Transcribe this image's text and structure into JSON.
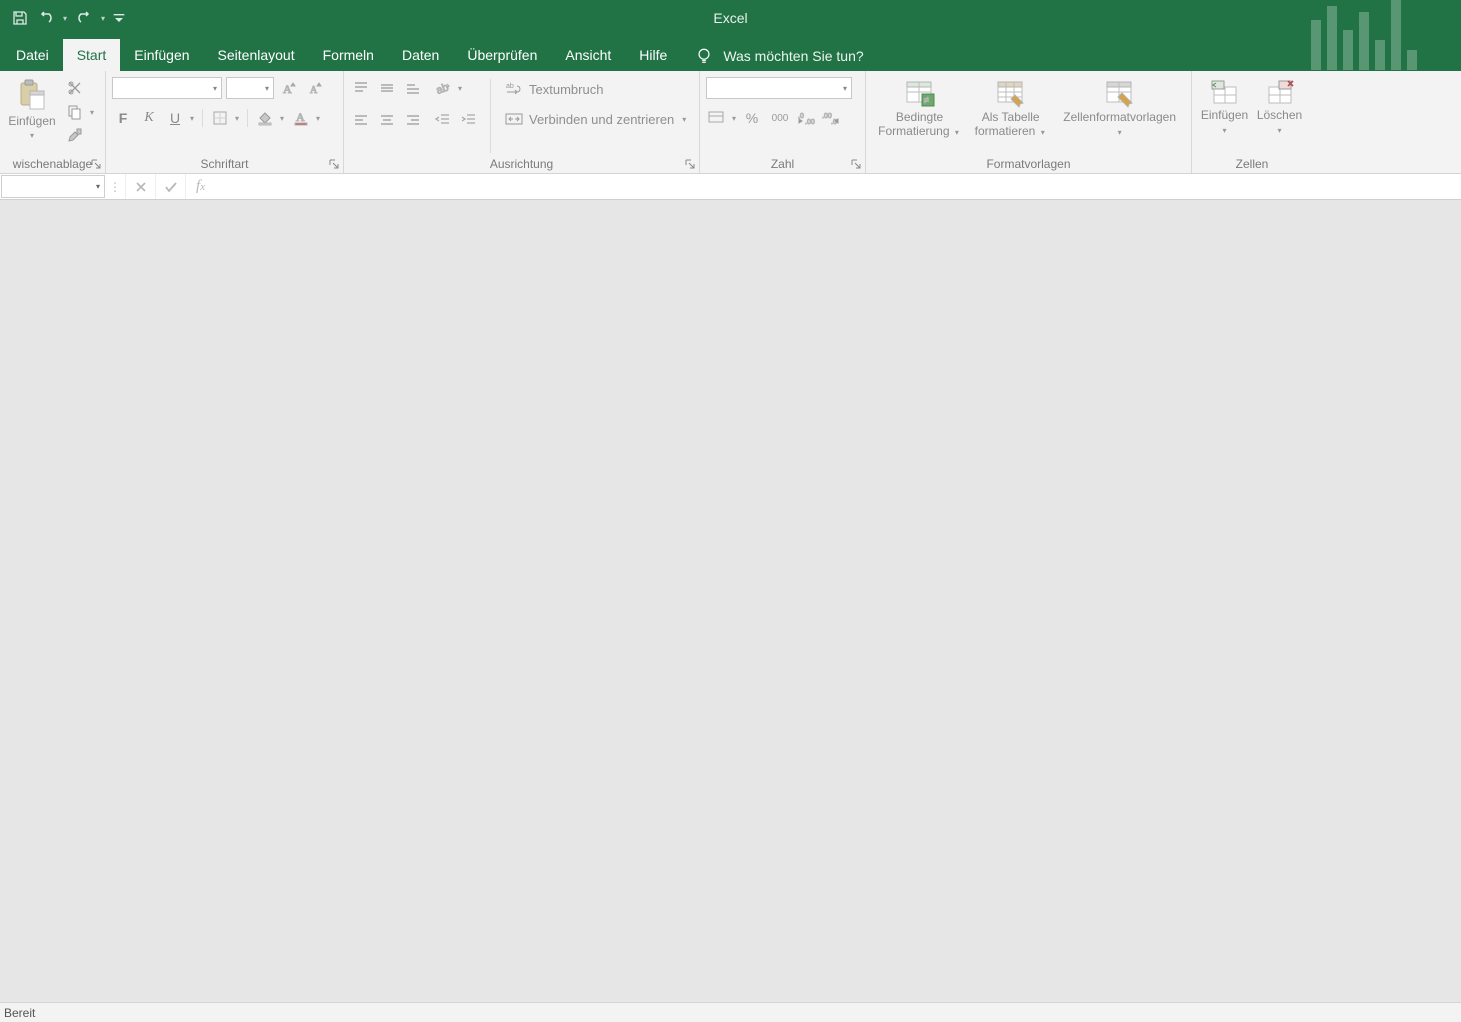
{
  "app": {
    "title": "Excel"
  },
  "tabs": {
    "datei": "Datei",
    "start": "Start",
    "einfuegen": "Einfügen",
    "seitenlayout": "Seitenlayout",
    "formeln": "Formeln",
    "daten": "Daten",
    "ueberpruefen": "Überprüfen",
    "ansicht": "Ansicht",
    "hilfe": "Hilfe",
    "tellme": "Was möchten Sie tun?"
  },
  "ribbon": {
    "clipboard": {
      "label": "wischenablage",
      "paste": "Einfügen"
    },
    "font": {
      "label": "Schriftart",
      "bold": "F",
      "italic": "K",
      "underline": "U"
    },
    "alignment": {
      "label": "Ausrichtung",
      "wrap": "Textumbruch",
      "merge": "Verbinden und zentrieren"
    },
    "number": {
      "label": "Zahl",
      "thousand": "000"
    },
    "styles": {
      "label": "Formatvorlagen",
      "conditional": "Bedingte Formatierung",
      "astable": "Als Tabelle formatieren",
      "cellstyles": "Zellenformatvorlagen"
    },
    "cells": {
      "label": "Zellen",
      "insert": "Einfügen",
      "delete": "Löschen"
    }
  },
  "status": {
    "ready": "Bereit"
  }
}
